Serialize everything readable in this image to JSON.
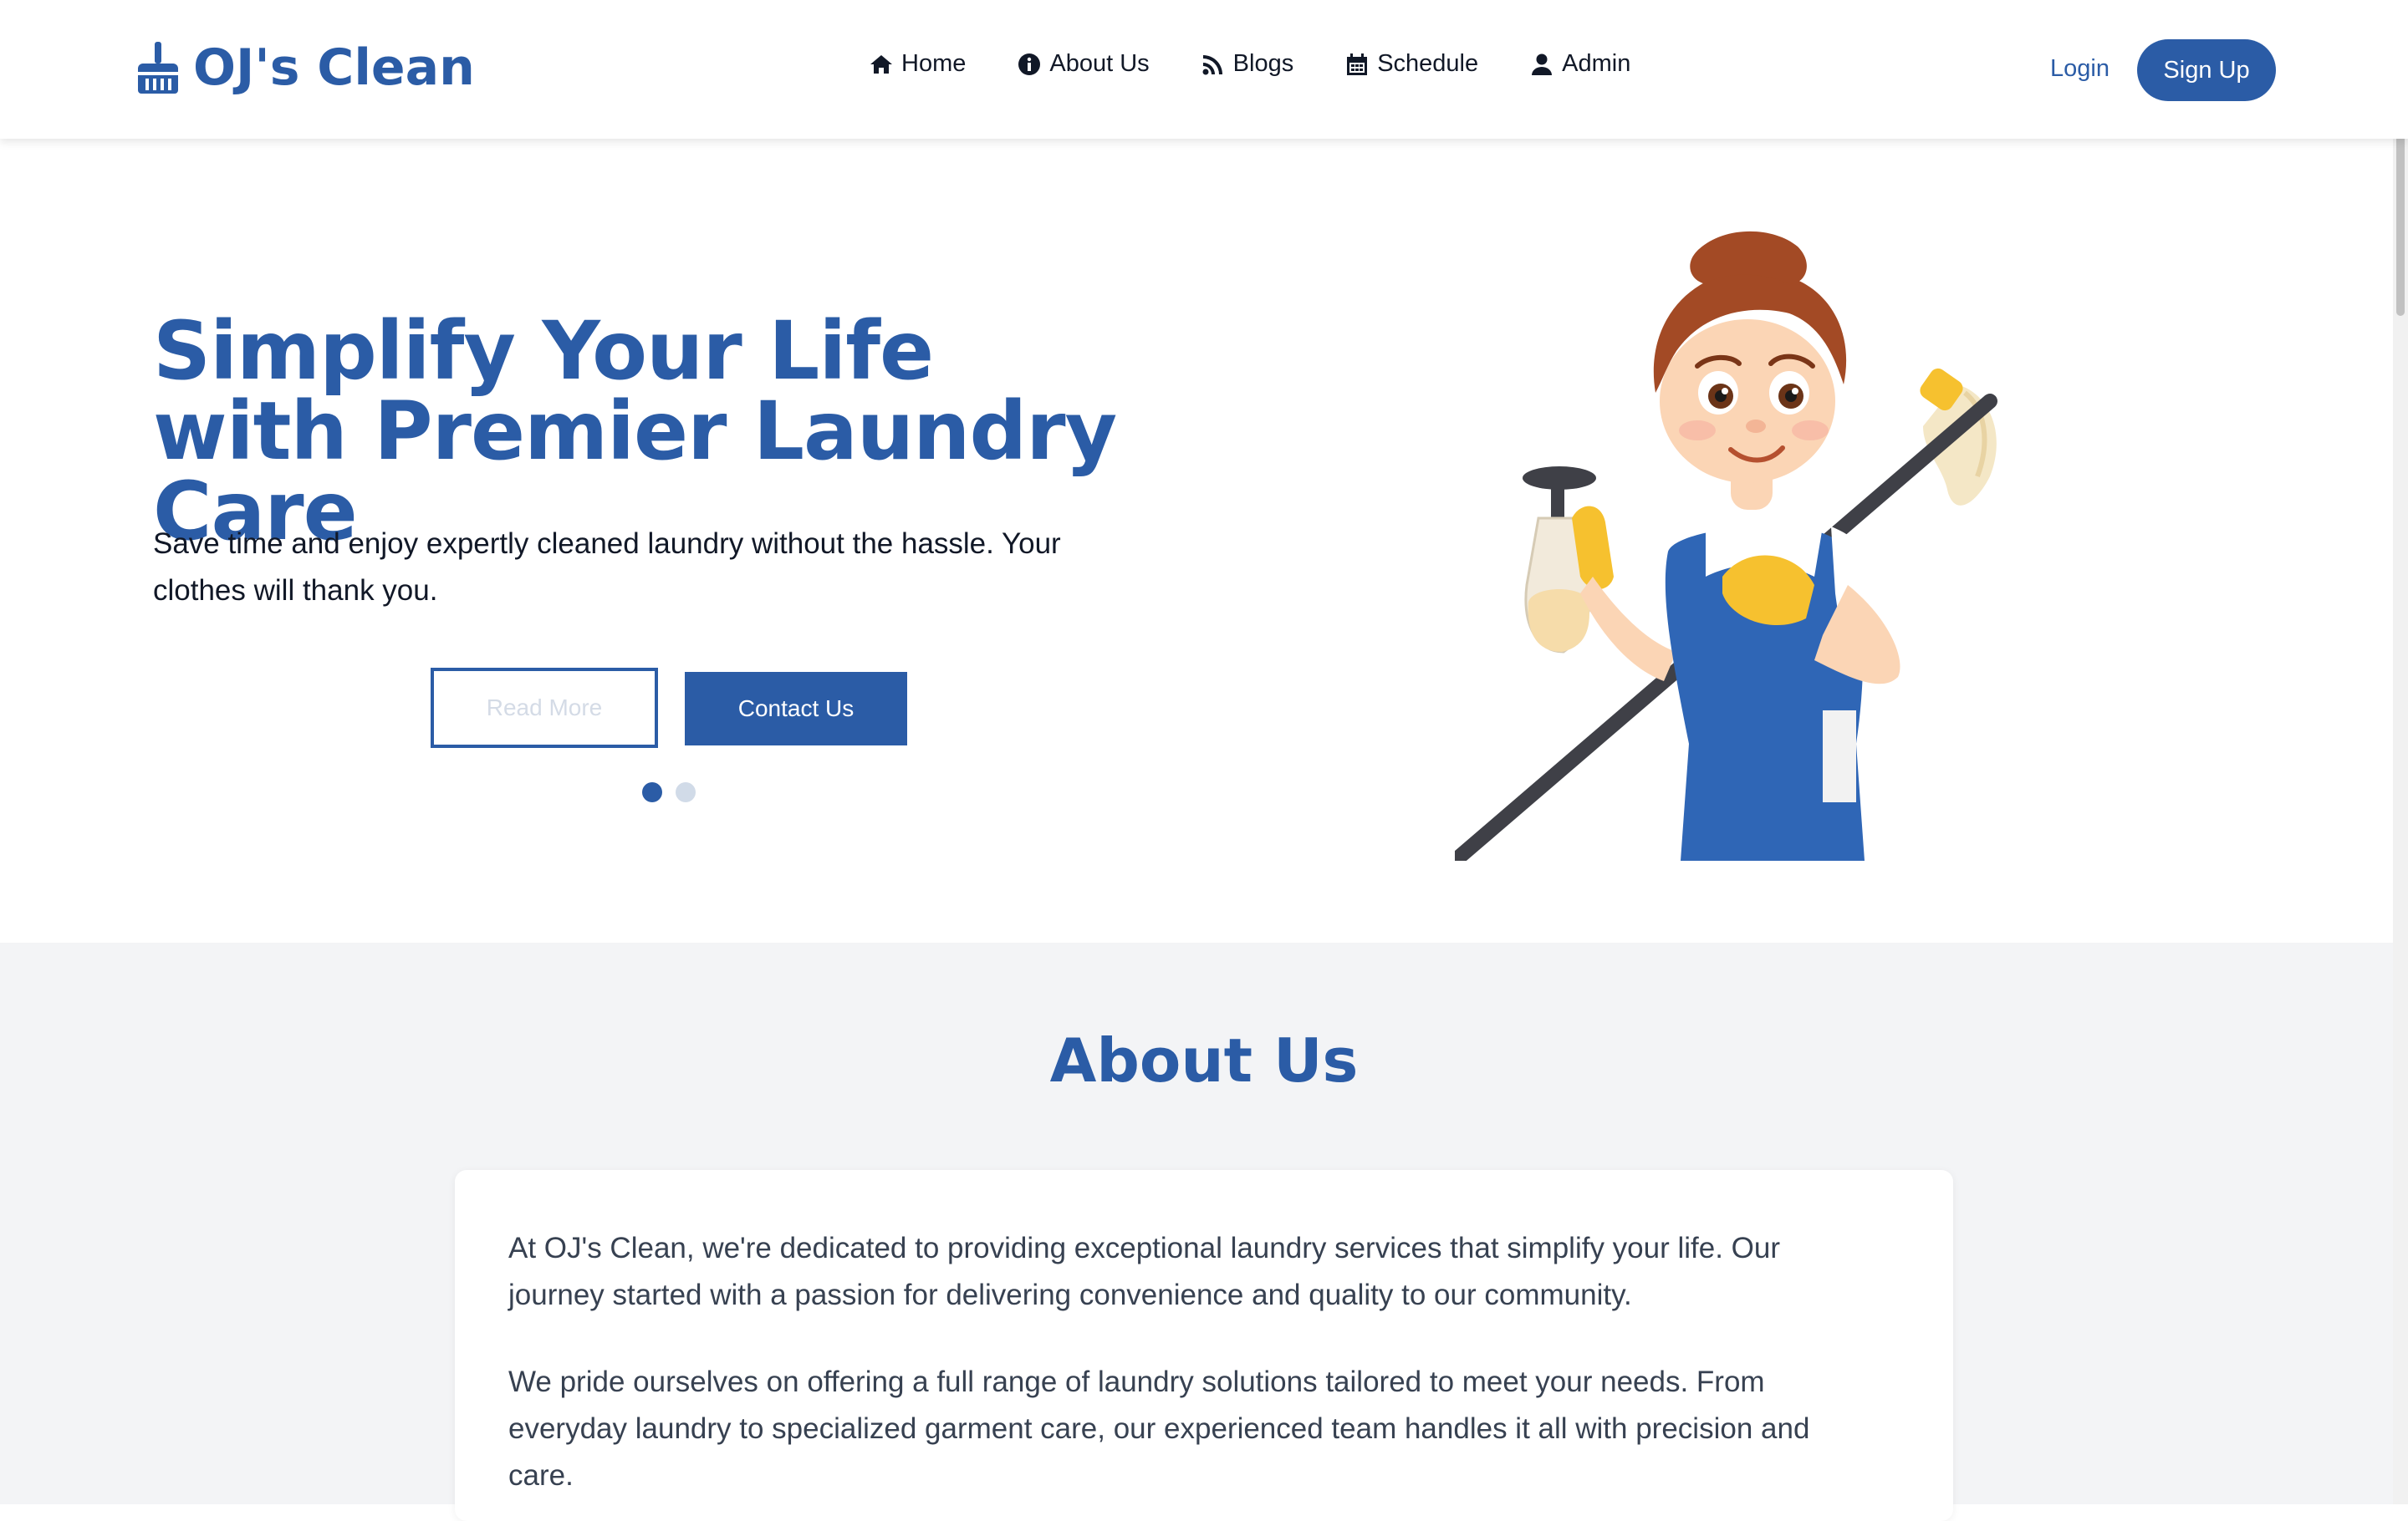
{
  "brand": {
    "name": "OJ's Clean",
    "icon": "broom-icon",
    "color": "#2b5ca6"
  },
  "nav": {
    "items": [
      {
        "label": "Home",
        "icon": "home-icon"
      },
      {
        "label": "About Us",
        "icon": "info-circle-icon"
      },
      {
        "label": "Blogs",
        "icon": "rss-icon"
      },
      {
        "label": "Schedule",
        "icon": "calendar-icon"
      },
      {
        "label": "Admin",
        "icon": "user-icon"
      }
    ]
  },
  "auth": {
    "login_label": "Login",
    "signup_label": "Sign Up"
  },
  "hero": {
    "title": "Simplify Your Life with Premier Laundry Care",
    "subtitle": "Save time and enjoy expertly cleaned laundry without the hassle. Your clothes will thank you.",
    "read_more_label": "Read More",
    "contact_label": "Contact Us",
    "carousel": {
      "slide_count": 2,
      "active_index": 0
    },
    "illustration": "cleaning-lady-illustration"
  },
  "about": {
    "title": "About Us",
    "paragraphs": [
      "At OJ's Clean, we're dedicated to providing exceptional laundry services that simplify your life. Our journey started with a passion for delivering convenience and quality to our community.",
      "We pride ourselves on offering a full range of laundry solutions tailored to meet your needs. From everyday laundry to specialized garment care, our experienced team handles it all with precision and care."
    ]
  },
  "colors": {
    "primary": "#2b5ca6",
    "section_bg": "#f3f4f6",
    "text": "#111827"
  }
}
